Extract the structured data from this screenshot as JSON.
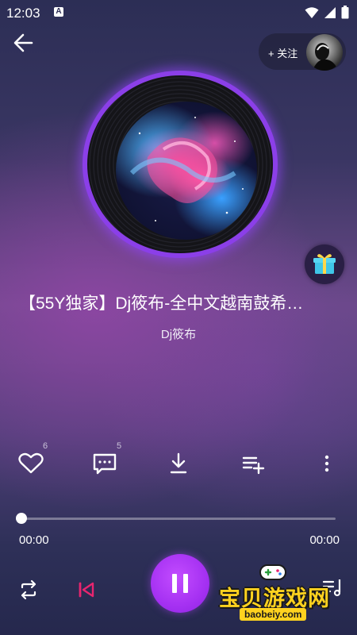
{
  "status_bar": {
    "time": "12:03",
    "notif_badge": "A"
  },
  "header": {
    "follow_label": "+ 关注"
  },
  "song": {
    "title": "【55Y独家】Dj筱布-全中文越南鼓希…",
    "artist": "Dj筱布"
  },
  "actions": {
    "like_count": "6",
    "comment_count": "5"
  },
  "player": {
    "current_time": "00:00",
    "total_time": "00:00",
    "progress": 0
  },
  "watermark": {
    "title": "宝贝游戏网",
    "url": "baobeiy.com"
  },
  "colors": {
    "accent": "#a531f2",
    "prev_icon": "#e8256f",
    "watermark": "#ffd21f"
  }
}
